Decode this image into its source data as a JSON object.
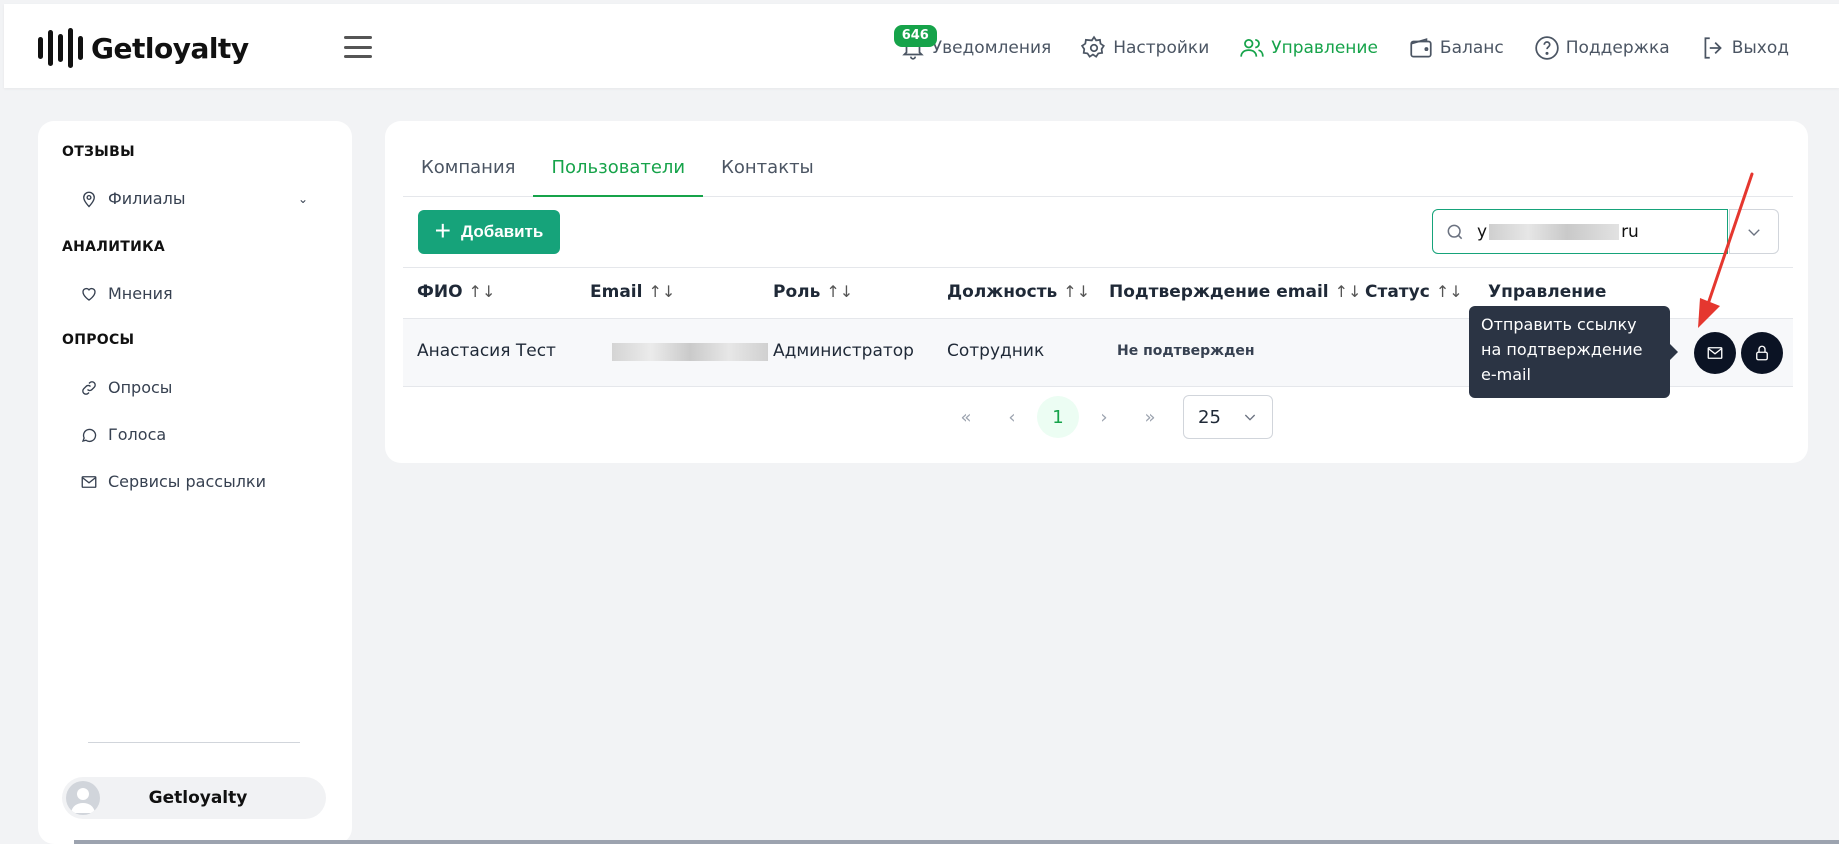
{
  "brand": {
    "name": "Getloyalty"
  },
  "nav": {
    "notifications": {
      "label": "Уведомления",
      "badge": "646"
    },
    "settings": {
      "label": "Настройки"
    },
    "management": {
      "label": "Управление"
    },
    "balance": {
      "label": "Баланс"
    },
    "support": {
      "label": "Поддержка"
    },
    "logout": {
      "label": "Выход"
    }
  },
  "colors": {
    "accent": "#16a37a",
    "active_nav": "#16a34a",
    "dark_button": "#0b1324",
    "tooltip_bg": "#2b3444",
    "arrow": "#e5372f"
  },
  "sidebar": {
    "sections": [
      {
        "title": "ОТЗЫВЫ",
        "items": [
          {
            "label": "Филиалы",
            "icon": "map-pin-icon",
            "expandable": true
          }
        ]
      },
      {
        "title": "АНАЛИТИКА",
        "items": [
          {
            "label": "Мнения",
            "icon": "heart-icon"
          }
        ]
      },
      {
        "title": "ОПРОСЫ",
        "items": [
          {
            "label": "Опросы",
            "icon": "link-icon"
          },
          {
            "label": "Голоса",
            "icon": "chat-bubble-icon"
          },
          {
            "label": "Сервисы рассылки",
            "icon": "mail-icon"
          }
        ]
      }
    ],
    "user": {
      "name": "Getloyalty"
    }
  },
  "tabs": [
    {
      "label": "Компания",
      "active": false
    },
    {
      "label": "Пользователи",
      "active": true
    },
    {
      "label": "Контакты",
      "active": false
    }
  ],
  "toolbar": {
    "add_label": "Добавить"
  },
  "search": {
    "value_prefix": "y",
    "value_suffix": "ru"
  },
  "table": {
    "columns": [
      "ФИО",
      "Email",
      "Роль",
      "Должность",
      "Подтверждение email",
      "Статус",
      "Управление"
    ],
    "sort_icon": "↑↓",
    "rows": [
      {
        "name": "Анастасия Тест",
        "role": "Администратор",
        "position": "Сотрудник",
        "email_confirm": "Не подтвержден"
      }
    ]
  },
  "tooltip": {
    "text": "Отправить ссылку на подтверждение e-mail"
  },
  "pagination": {
    "first": "«",
    "prev": "‹",
    "current": "1",
    "next": "›",
    "last": "»",
    "page_size": "25"
  }
}
